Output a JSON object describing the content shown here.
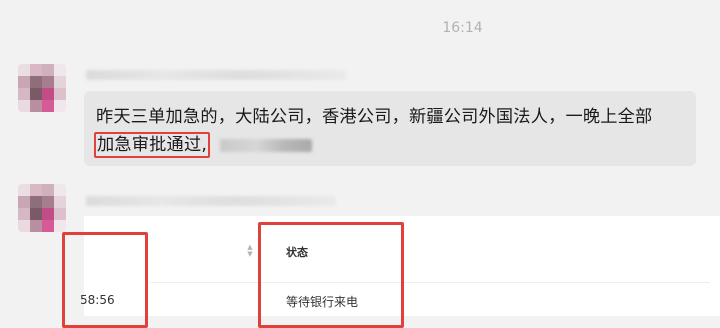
{
  "chat": {
    "timestamp": "16:14",
    "messages": [
      {
        "line1": "昨天三单加急的，大陆公司，香港公司，新疆公司外国法人，一晚上全部",
        "highlight": "加急审批通过,"
      }
    ],
    "screenshot": {
      "column_status": "状态",
      "row_time": "58:56",
      "row_status": "等待银行来电"
    }
  },
  "colors": {
    "background": "#f2f2f2",
    "bubble": "#e6e6e6",
    "highlight_border": "#e0413d",
    "timestamp": "#b2b2b2"
  },
  "icons": [
    "sort-icon"
  ]
}
